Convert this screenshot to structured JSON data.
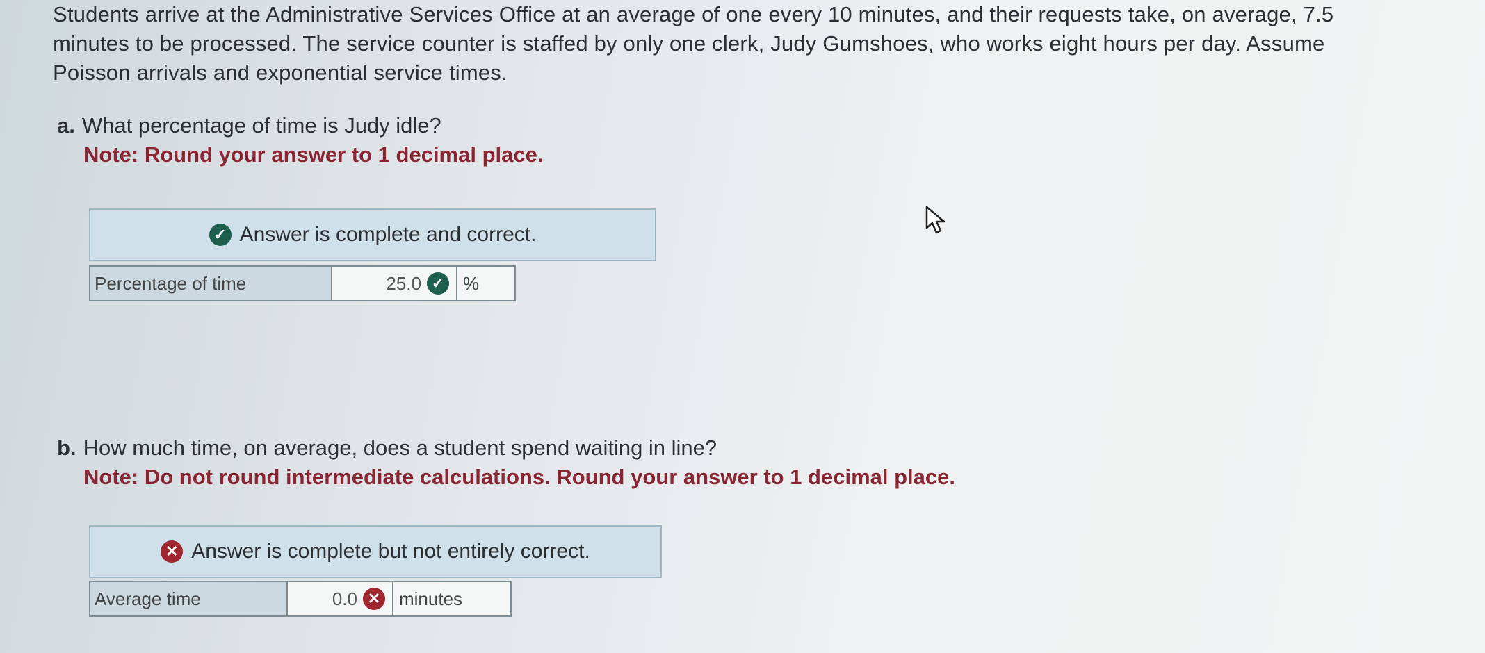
{
  "problem": {
    "lines": [
      "Students arrive at the Administrative Services Office at an average of one every 10 minutes, and their requests take, on average, 7.5",
      "minutes to be processed. The service counter is staffed by only one clerk, Judy Gumshoes, who works eight hours per day. Assume",
      "Poisson arrivals and exponential service times."
    ]
  },
  "part_a": {
    "label": "a.",
    "question": "What percentage of time is Judy idle?",
    "note": "Note: Round your answer to 1 decimal place.",
    "status": "Answer is complete and correct.",
    "status_type": "correct",
    "row_label": "Percentage of time",
    "value": "25.0",
    "unit": "%"
  },
  "part_b": {
    "label": "b.",
    "question": "How much time, on average, does a student spend waiting in line?",
    "note": "Note: Do not round intermediate calculations. Round your answer to 1 decimal place.",
    "status": "Answer is complete but not entirely correct.",
    "status_type": "incorrect",
    "row_label": "Average time",
    "value": "0.0",
    "unit": "minutes"
  },
  "icons": {
    "correct": "check-circle-icon",
    "incorrect": "x-circle-icon",
    "cursor": "mouse-pointer-icon"
  },
  "colors": {
    "correct": "#1f5f4e",
    "incorrect": "#a0262f",
    "note_text": "#8a2533",
    "banner_bg": "#cfe0ea"
  }
}
